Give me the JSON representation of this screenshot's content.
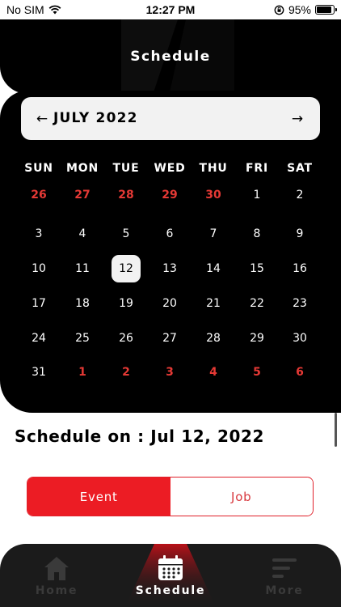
{
  "status_bar": {
    "carrier": "No SIM",
    "time": "12:27 PM",
    "battery": "95%",
    "battery_level": 0.95
  },
  "header": {
    "title": "Schedule"
  },
  "calendar": {
    "month_label": "JULY 2022",
    "prev_icon": "arrow-left-icon",
    "next_icon": "arrow-right-icon",
    "weekdays": [
      "SUN",
      "MON",
      "TUE",
      "WED",
      "THU",
      "FRI",
      "SAT"
    ],
    "weeks": [
      [
        {
          "d": "26",
          "o": true
        },
        {
          "d": "27",
          "o": true
        },
        {
          "d": "28",
          "o": true
        },
        {
          "d": "29",
          "o": true
        },
        {
          "d": "30",
          "o": true
        },
        {
          "d": "1"
        },
        {
          "d": "2"
        }
      ],
      [
        {
          "d": "3"
        },
        {
          "d": "4"
        },
        {
          "d": "5"
        },
        {
          "d": "6"
        },
        {
          "d": "7"
        },
        {
          "d": "8"
        },
        {
          "d": "9"
        }
      ],
      [
        {
          "d": "10"
        },
        {
          "d": "11"
        },
        {
          "d": "12",
          "s": true
        },
        {
          "d": "13"
        },
        {
          "d": "14"
        },
        {
          "d": "15"
        },
        {
          "d": "16"
        }
      ],
      [
        {
          "d": "17"
        },
        {
          "d": "18"
        },
        {
          "d": "19"
        },
        {
          "d": "20"
        },
        {
          "d": "21"
        },
        {
          "d": "22"
        },
        {
          "d": "23"
        }
      ],
      [
        {
          "d": "24"
        },
        {
          "d": "25"
        },
        {
          "d": "26"
        },
        {
          "d": "27"
        },
        {
          "d": "28"
        },
        {
          "d": "29"
        },
        {
          "d": "30"
        }
      ],
      [
        {
          "d": "31"
        },
        {
          "d": "1",
          "o": true
        },
        {
          "d": "2",
          "o": true
        },
        {
          "d": "3",
          "o": true
        },
        {
          "d": "4",
          "o": true
        },
        {
          "d": "5",
          "o": true
        },
        {
          "d": "6",
          "o": true
        }
      ]
    ]
  },
  "schedule": {
    "heading": "Schedule on : Jul 12, 2022",
    "tabs": [
      {
        "label": "Event",
        "active": true
      },
      {
        "label": "Job",
        "active": false
      }
    ]
  },
  "tabbar": {
    "items": [
      {
        "label": "Home",
        "icon": "home-icon",
        "active": false
      },
      {
        "label": "Schedule",
        "icon": "calendar-icon",
        "active": true
      },
      {
        "label": "More",
        "icon": "menu-icon",
        "active": false
      }
    ]
  },
  "colors": {
    "accent": "#ec1c24",
    "dark": "#000000",
    "light": "#f2f2f2",
    "other_month": "#e53935"
  }
}
